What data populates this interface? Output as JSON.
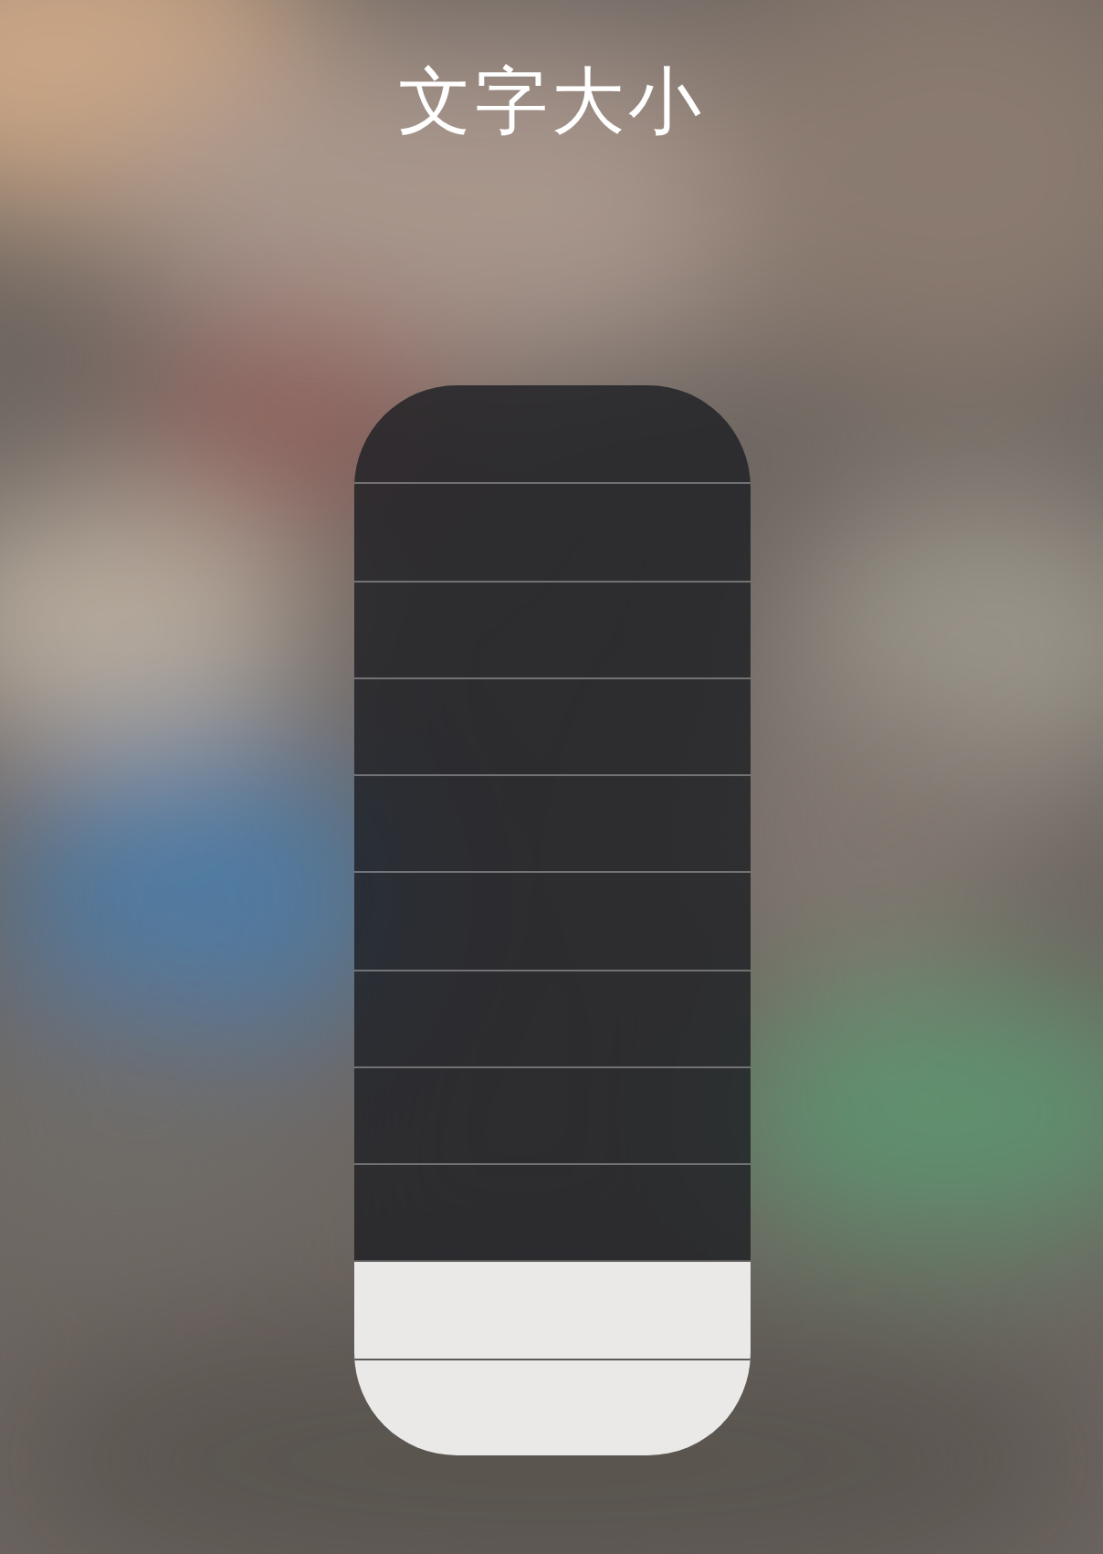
{
  "title": "文字大小",
  "slider": {
    "level": 0.182
  }
}
